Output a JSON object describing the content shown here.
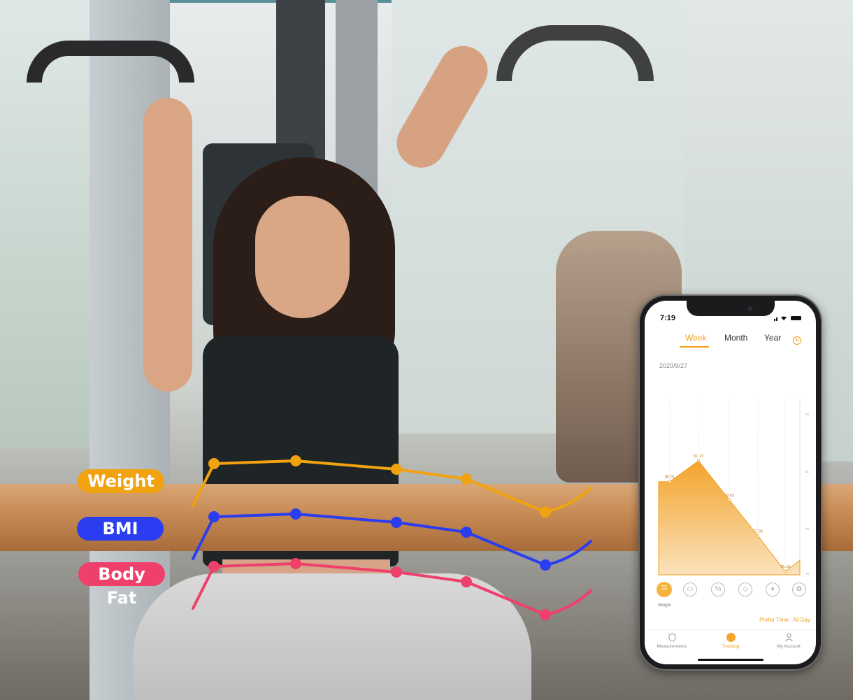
{
  "overlay": {
    "labels": {
      "weight": "Weight",
      "bmi": "BMI",
      "body_fat": "Body Fat"
    },
    "colors": {
      "weight": "#f1a20f",
      "bmi": "#2a3df0",
      "body_fat": "#ef3f6b"
    }
  },
  "phone": {
    "status_time": "7:19",
    "tabs": {
      "week": "Week",
      "month": "Month",
      "year": "Year"
    },
    "selected_tab": "Week",
    "date": "2020/9/27",
    "accent_color": "#f0a01c",
    "metric_icons": [
      "weight-icon",
      "bmi-icon",
      "body-fat-icon",
      "water-icon",
      "muscle-icon",
      "bone-icon"
    ],
    "selected_metric_caption": "Weight",
    "prefer_time_label": "Prefer Time:",
    "prefer_time_value": "All Day",
    "nav": {
      "measurements": "Measurements",
      "tracking": "Tracking",
      "account": "My Account"
    }
  },
  "chart_data": {
    "type": "area",
    "title": "",
    "series": [
      {
        "values": [
          80.01,
          81.13,
          79.03,
          77.09,
          75.18
        ]
      }
    ],
    "data_labels": [
      "80.01",
      "81.13",
      "79.03",
      "77.09",
      "75.18"
    ],
    "y_ticks": [
      "84",
      "81",
      "78",
      "75"
    ],
    "ylim": [
      75,
      84
    ],
    "grid": "vertical-dashed"
  }
}
